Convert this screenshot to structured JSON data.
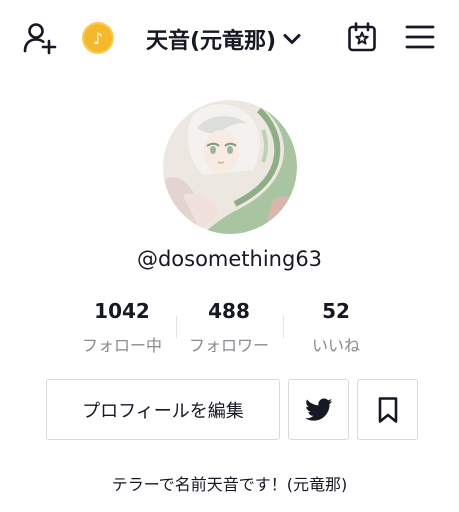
{
  "header": {
    "account_name": "天音(元竜那)",
    "coin_glyph": "♪",
    "icons": [
      "add-friend-icon",
      "coin-icon",
      "chevron-down-icon",
      "calendar-star-icon",
      "menu-icon"
    ],
    "coin_color": "#f5b82a"
  },
  "profile": {
    "username": "@dosomething63",
    "avatar": "profile-photo"
  },
  "stats": [
    {
      "value": "1042",
      "label": "フォロー中"
    },
    {
      "value": "488",
      "label": "フォロワー"
    },
    {
      "value": "52",
      "label": "いいね"
    }
  ],
  "actions": {
    "edit_profile_label": "プロフィールを編集",
    "twitter_icon": "twitter-icon",
    "bookmark_icon": "bookmark-icon"
  },
  "bio": "テラーで名前天音です！(元竜那)",
  "colors": {
    "text": "#161823",
    "muted": "#8a8b91",
    "border": "#d9d9dc"
  }
}
